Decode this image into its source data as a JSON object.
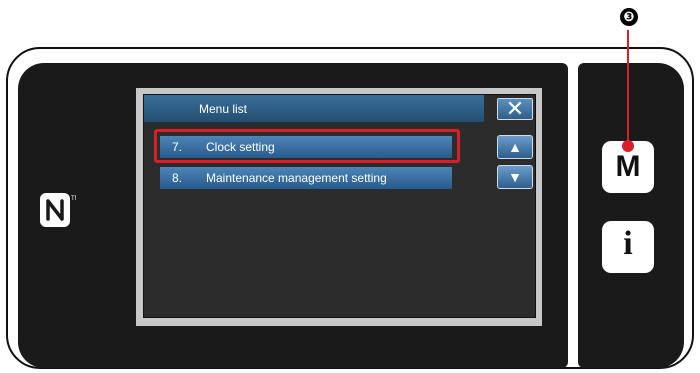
{
  "window": {
    "title": "Menu list"
  },
  "controls": {
    "close_icon": "close-icon",
    "close_label": "✕",
    "up_label": "▲",
    "down_label": "▼"
  },
  "menu": {
    "items": [
      {
        "number": "7.",
        "label": "Clock setting",
        "selected": true
      },
      {
        "number": "8.",
        "label": "Maintenance management setting",
        "selected": false
      }
    ]
  },
  "side_buttons": {
    "mode_label": "M",
    "info_label": "i"
  },
  "callout": {
    "marker": "❸"
  },
  "colors": {
    "highlight": "#d8202a",
    "accent_blue": "#265b8c",
    "panel": "#1a1a1a"
  }
}
